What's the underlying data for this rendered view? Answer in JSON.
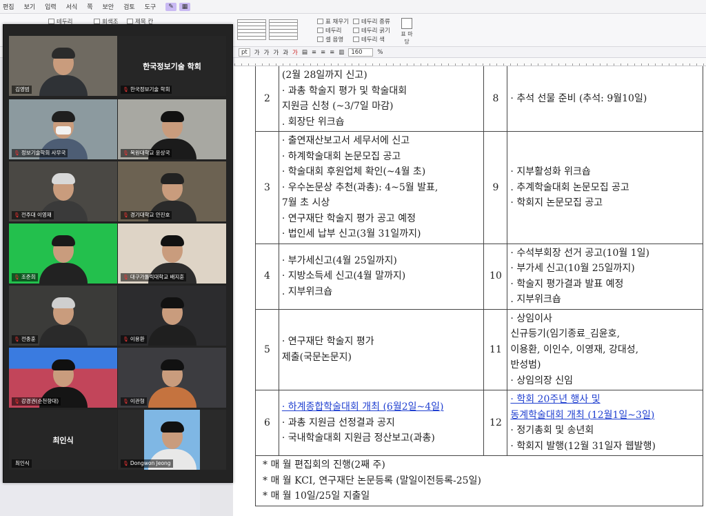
{
  "menubar": {
    "items": [
      "편집",
      "보기",
      "입력",
      "서식",
      "쪽",
      "보안",
      "검토",
      "도구"
    ]
  },
  "toolbar": {
    "check1": "테두리",
    "check2": "회색조",
    "check3": "제목 칸",
    "cell_group": [
      "표 채우기",
      "테두리",
      "셀 음영"
    ],
    "border_group": [
      "테두리 종류",
      "테두리 굵기",
      "테두리 색"
    ],
    "table_button": "표 마당"
  },
  "fmtbar": {
    "size_unit": "pt",
    "zoom": "160",
    "zoom_unit": "%"
  },
  "schedule": {
    "rows": [
      {
        "left_num": "2",
        "left": [
          "(2월 28일까지 신고)",
          "· 과총 학술지 평가 및 학술대회",
          "  지원금 신청 (~3/7일 마감)",
          ". 회장단 위크숍"
        ],
        "right_num": "8",
        "right": [
          "· 추석 선물 준비 (추석: 9월10일)"
        ]
      },
      {
        "left_num": "3",
        "left": [
          "· 출연재산보고서 세무서에 신고",
          "· 하계학술대회 논문모집 공고",
          "· 학술대회 후원업체 확인(~4월 초)",
          "· 우수논문상 추천(과총): 4~5월 발표,",
          "  7월 초 시상",
          "· 연구재단 학술지 평가 공고 예정",
          "· 법인세 납부 신고(3월 31일까지)"
        ],
        "right_num": "9",
        "right": [
          "· 지부활성화 위크숍",
          ". 추계학술대회 논문모집 공고",
          "· 학회지 논문모집 공고"
        ]
      },
      {
        "left_num": "4",
        "left": [
          "· 부가세신고(4월 25일까지)",
          "· 지방소득세 신고(4월 말까지)",
          ". 지부위크숍"
        ],
        "right_num": "10",
        "right": [
          "· 수석부회장 선거 공고(10월 1일)",
          "· 부가세 신고(10월 25일까지)",
          "· 학술지 평가결과 발표 예정",
          ". 지부위크숍"
        ]
      },
      {
        "left_num": "5",
        "left": [
          "· 연구재단 학술지 평가",
          "제출(국문논문지)"
        ],
        "right_num": "11",
        "right": [
          "· 상임이사",
          "신규등기(임기종료_김윤호,",
          "이용환, 이인수, 이영재, 강대성,",
          "반성범)",
          "· 상임의장 신임"
        ]
      },
      {
        "left_num": "6",
        "left": [
          "· 하계종합학술대회 개최 (6월2일~4일)",
          "· 과총 지원금 선정결과 공지",
          "· 국내학술대회 지원금 정산보고(과총)"
        ],
        "right_num": "12",
        "right": [
          "· 학회 20주년 행사 및",
          "동계학술대회 개최 (12월1일~3일)",
          "· 정기총회 및 송년회",
          "· 학회지 발행(12월 31일자 웹발행)"
        ]
      }
    ],
    "notes": [
      "* 매 월 편집회의 진행(2째 주)",
      "* 매 월 KCI, 연구재단 논문등록 (말일이전등록-25일)",
      "* 매 월 10일/25일 지출일"
    ]
  },
  "video_call": {
    "tiles": [
      {
        "name": "김영범"
      },
      {
        "name": "한국정보기술 학회",
        "center": "한국정보기술 학회"
      },
      {
        "name": "정보기술학회 사무국"
      },
      {
        "name": "목원대학교 윤상국"
      },
      {
        "name": "전주대 이영재"
      },
      {
        "name": "경기대학교 안진호"
      },
      {
        "name": "조준희"
      },
      {
        "name": "대구가톨릭대학교 배지훈"
      },
      {
        "name": "전종훈"
      },
      {
        "name": "이용환"
      },
      {
        "name": "강경권(순천향대)"
      },
      {
        "name": "이관형"
      },
      {
        "name": "최인식",
        "center": "최인식"
      },
      {
        "name": "Dongwon Jeong"
      }
    ]
  }
}
